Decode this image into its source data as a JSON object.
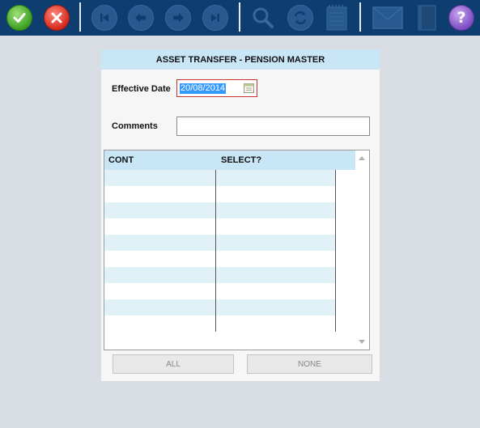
{
  "toolbar": {
    "buttons": [
      {
        "name": "ok-button",
        "icon": "checkmark-icon"
      },
      {
        "name": "cancel-button",
        "icon": "close-icon"
      },
      {
        "name": "first-record-button",
        "icon": "first-icon"
      },
      {
        "name": "previous-record-button",
        "icon": "arrow-left-icon"
      },
      {
        "name": "next-record-button",
        "icon": "arrow-right-icon"
      },
      {
        "name": "last-record-button",
        "icon": "last-icon"
      },
      {
        "name": "search-button",
        "icon": "magnifier-icon"
      },
      {
        "name": "refresh-button",
        "icon": "refresh-icon"
      },
      {
        "name": "notepad-button",
        "icon": "notepad-icon"
      },
      {
        "name": "mail-button",
        "icon": "envelope-icon"
      },
      {
        "name": "book-button",
        "icon": "book-icon"
      },
      {
        "name": "help-button",
        "icon": "question-icon"
      }
    ],
    "colors": {
      "background": "#0e3d70",
      "ok": "#3aa020",
      "cancel": "#d42a1e",
      "help": "#7d4cc4"
    }
  },
  "dialog": {
    "title": "ASSET TRANSFER - PENSION MASTER",
    "effective_date_label": "Effective Date",
    "effective_date_value": "20/08/2014",
    "comments_label": "Comments",
    "comments_value": "",
    "grid": {
      "columns": [
        "CONT",
        "SELECT?"
      ],
      "rows": []
    },
    "all_button": "ALL",
    "none_button": "NONE"
  },
  "colors": {
    "header_blue": "#c8e6f6",
    "row_alt": "#e1f1f8",
    "date_border": "#cc3333",
    "selection": "#3399ff"
  }
}
